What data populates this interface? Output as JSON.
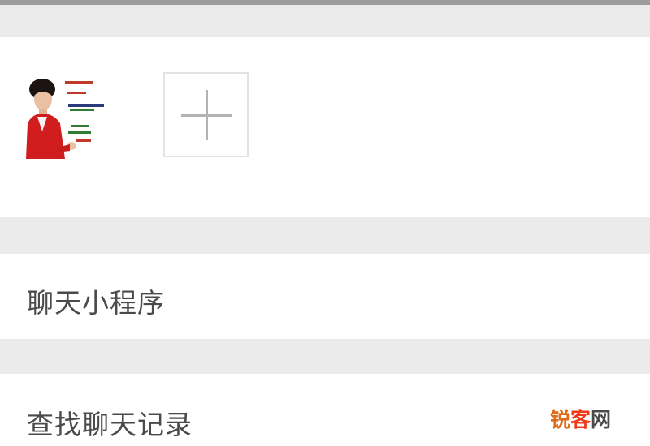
{
  "chat_info": {
    "members": [
      {
        "type": "avatar",
        "icon": "contact-avatar-icon"
      }
    ],
    "add_member_icon": "plus-icon",
    "rows": [
      {
        "label": "聊天小程序"
      },
      {
        "label": "查找聊天记录"
      }
    ]
  },
  "watermark": {
    "text_part1": "锐",
    "text_part2": "客",
    "text_part3": "网"
  },
  "colors": {
    "section_gap": "#ebebeb",
    "panel": "#ffffff",
    "text": "#4a4a4a",
    "plus": "#b3b3b3"
  }
}
